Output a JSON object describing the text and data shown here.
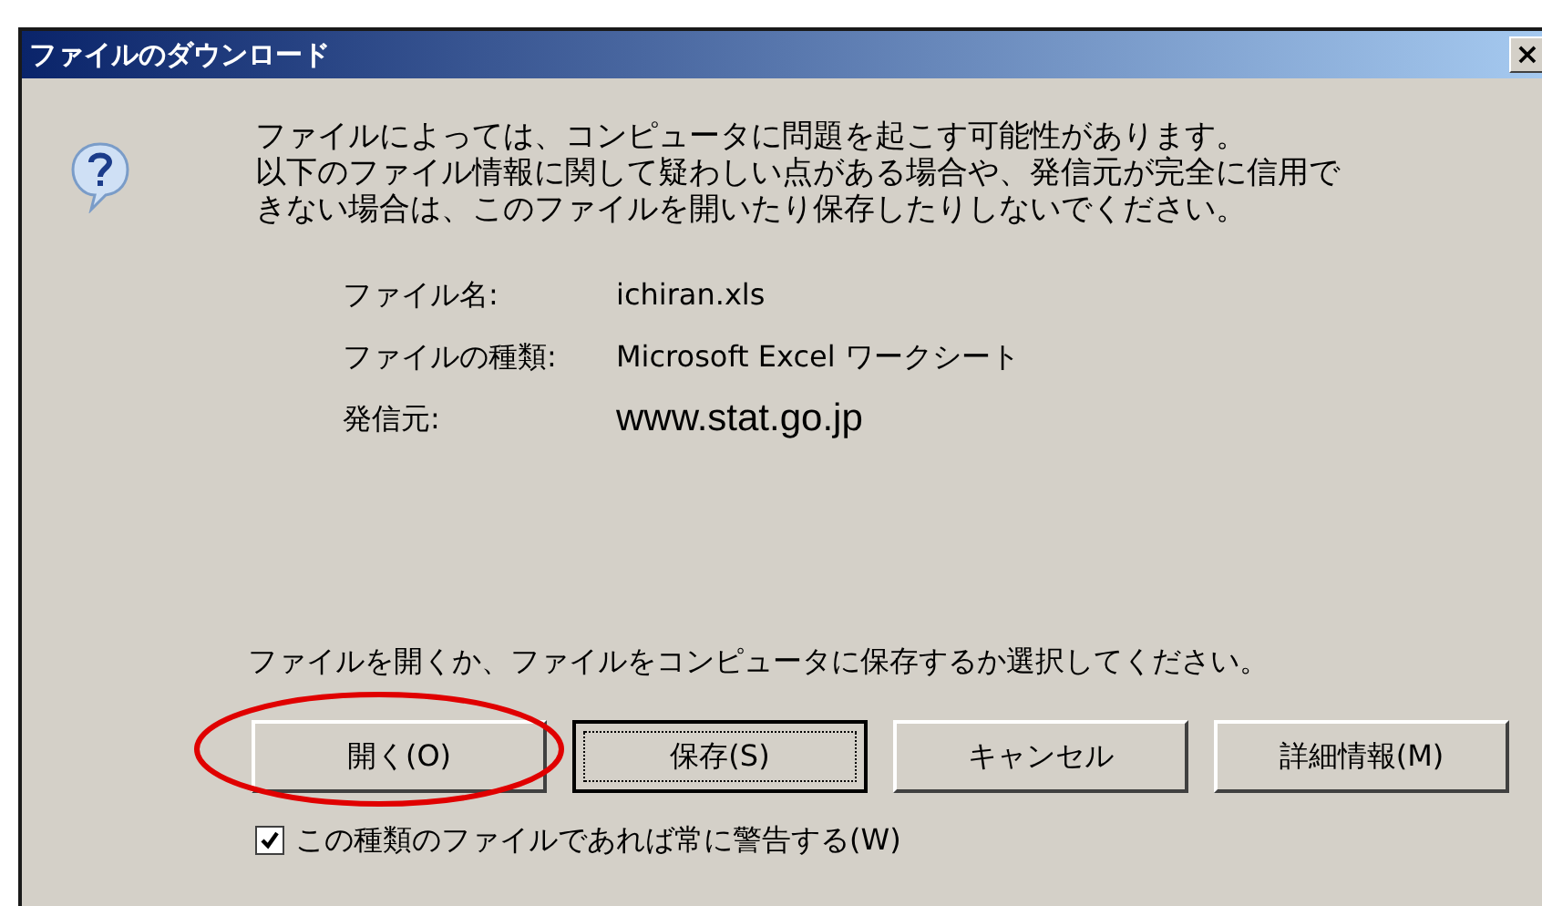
{
  "window": {
    "title": "ファイルのダウンロード",
    "close": "×"
  },
  "message": [
    "ファイルによっては、コンピュータに問題を起こす可能性があります。",
    "以下のファイル情報に関して疑わしい点がある場合や、発信元が完全に信用で",
    "きない場合は、このファイルを開いたり保存したりしないでください。"
  ],
  "file_info": [
    {
      "label": "ファイル名:",
      "value": "ichiran.xls",
      "kind": "plain"
    },
    {
      "label": "ファイルの種類:",
      "value": "Microsoft Excel ワークシート",
      "kind": "plain"
    },
    {
      "label": "発信元:",
      "value": "www.stat.go.jp",
      "kind": "large"
    }
  ],
  "prompt": "ファイルを開くか、ファイルをコンピュータに保存するか選択してください。",
  "buttons": [
    {
      "label": "開く(O)",
      "focused": false,
      "circled": true
    },
    {
      "label": "保存(S)",
      "focused": true,
      "circled": false
    },
    {
      "label": "キャンセル",
      "focused": false,
      "circled": false
    },
    {
      "label": "詳細情報(M)",
      "focused": false,
      "circled": false
    }
  ],
  "warn_checkbox": {
    "label": "この種類のファイルであれば常に警告する(W)",
    "checked": true
  }
}
